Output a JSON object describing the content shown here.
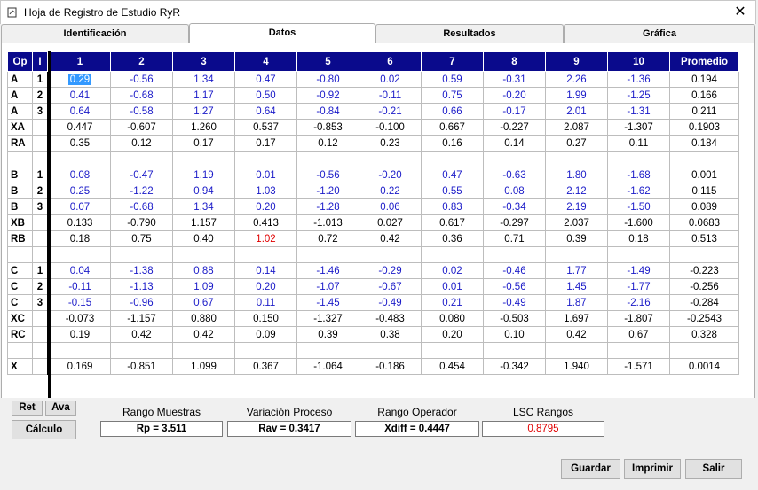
{
  "window": {
    "title": "Hoja de Registro de Estudio RyR",
    "close_label": "✕"
  },
  "tabs": [
    "Identificación",
    "Datos",
    "Resultados",
    "Gráfica"
  ],
  "active_tab": 1,
  "grid": {
    "header": [
      "Op",
      "I",
      "1",
      "2",
      "3",
      "4",
      "5",
      "6",
      "7",
      "8",
      "9",
      "10",
      "Promedio"
    ],
    "rows": [
      {
        "op": "A",
        "i": "1",
        "vals": [
          "0.29",
          "-0.56",
          "1.34",
          "0.47",
          "-0.80",
          "0.02",
          "0.59",
          "-0.31",
          "2.26",
          "-1.36"
        ],
        "prom": "0.194",
        "type": "data"
      },
      {
        "op": "A",
        "i": "2",
        "vals": [
          "0.41",
          "-0.68",
          "1.17",
          "0.50",
          "-0.92",
          "-0.11",
          "0.75",
          "-0.20",
          "1.99",
          "-1.25"
        ],
        "prom": "0.166",
        "type": "data"
      },
      {
        "op": "A",
        "i": "3",
        "vals": [
          "0.64",
          "-0.58",
          "1.27",
          "0.64",
          "-0.84",
          "-0.21",
          "0.66",
          "-0.17",
          "2.01",
          "-1.31"
        ],
        "prom": "0.211",
        "type": "data"
      },
      {
        "op": "XA",
        "i": "",
        "vals": [
          "0.447",
          "-0.607",
          "1.260",
          "0.537",
          "-0.853",
          "-0.100",
          "0.667",
          "-0.227",
          "2.087",
          "-1.307"
        ],
        "prom": "0.1903",
        "type": "calc"
      },
      {
        "op": "RA",
        "i": "",
        "vals": [
          "0.35",
          "0.12",
          "0.17",
          "0.17",
          "0.12",
          "0.23",
          "0.16",
          "0.14",
          "0.27",
          "0.11"
        ],
        "prom": "0.184",
        "type": "calc"
      },
      {
        "op": "",
        "i": "",
        "vals": [
          "",
          "",
          "",
          "",
          "",
          "",
          "",
          "",
          "",
          ""
        ],
        "prom": "",
        "type": "blank"
      },
      {
        "op": "B",
        "i": "1",
        "vals": [
          "0.08",
          "-0.47",
          "1.19",
          "0.01",
          "-0.56",
          "-0.20",
          "0.47",
          "-0.63",
          "1.80",
          "-1.68"
        ],
        "prom": "0.001",
        "type": "data"
      },
      {
        "op": "B",
        "i": "2",
        "vals": [
          "0.25",
          "-1.22",
          "0.94",
          "1.03",
          "-1.20",
          "0.22",
          "0.55",
          "0.08",
          "2.12",
          "-1.62"
        ],
        "prom": "0.115",
        "type": "data"
      },
      {
        "op": "B",
        "i": "3",
        "vals": [
          "0.07",
          "-0.68",
          "1.34",
          "0.20",
          "-1.28",
          "0.06",
          "0.83",
          "-0.34",
          "2.19",
          "-1.50"
        ],
        "prom": "0.089",
        "type": "data"
      },
      {
        "op": "XB",
        "i": "",
        "vals": [
          "0.133",
          "-0.790",
          "1.157",
          "0.413",
          "-1.013",
          "0.027",
          "0.617",
          "-0.297",
          "2.037",
          "-1.600"
        ],
        "prom": "0.0683",
        "type": "calc"
      },
      {
        "op": "RB",
        "i": "",
        "vals": [
          "0.18",
          "0.75",
          "0.40",
          "1.02",
          "0.72",
          "0.42",
          "0.36",
          "0.71",
          "0.39",
          "0.18"
        ],
        "prom": "0.513",
        "type": "calc",
        "red_index": 3
      },
      {
        "op": "",
        "i": "",
        "vals": [
          "",
          "",
          "",
          "",
          "",
          "",
          "",
          "",
          "",
          ""
        ],
        "prom": "",
        "type": "blank"
      },
      {
        "op": "C",
        "i": "1",
        "vals": [
          "0.04",
          "-1.38",
          "0.88",
          "0.14",
          "-1.46",
          "-0.29",
          "0.02",
          "-0.46",
          "1.77",
          "-1.49"
        ],
        "prom": "-0.223",
        "type": "data"
      },
      {
        "op": "C",
        "i": "2",
        "vals": [
          "-0.11",
          "-1.13",
          "1.09",
          "0.20",
          "-1.07",
          "-0.67",
          "0.01",
          "-0.56",
          "1.45",
          "-1.77"
        ],
        "prom": "-0.256",
        "type": "data"
      },
      {
        "op": "C",
        "i": "3",
        "vals": [
          "-0.15",
          "-0.96",
          "0.67",
          "0.11",
          "-1.45",
          "-0.49",
          "0.21",
          "-0.49",
          "1.87",
          "-2.16"
        ],
        "prom": "-0.284",
        "type": "data"
      },
      {
        "op": "XC",
        "i": "",
        "vals": [
          "-0.073",
          "-1.157",
          "0.880",
          "0.150",
          "-1.327",
          "-0.483",
          "0.080",
          "-0.503",
          "1.697",
          "-1.807"
        ],
        "prom": "-0.2543",
        "type": "calc"
      },
      {
        "op": "RC",
        "i": "",
        "vals": [
          "0.19",
          "0.42",
          "0.42",
          "0.09",
          "0.39",
          "0.38",
          "0.20",
          "0.10",
          "0.42",
          "0.67"
        ],
        "prom": "0.328",
        "type": "calc"
      },
      {
        "op": "",
        "i": "",
        "vals": [
          "",
          "",
          "",
          "",
          "",
          "",
          "",
          "",
          "",
          ""
        ],
        "prom": "",
        "type": "blank"
      },
      {
        "op": "X",
        "i": "",
        "vals": [
          "0.169",
          "-0.851",
          "1.099",
          "0.367",
          "-1.064",
          "-0.186",
          "0.454",
          "-0.342",
          "1.940",
          "-1.571"
        ],
        "prom": "0.0014",
        "type": "calc"
      }
    ]
  },
  "controls": {
    "ret_label": "Ret",
    "ava_label": "Ava",
    "calculo_label": "Cálculo",
    "rango_muestras_label": "Rango Muestras",
    "rango_muestras_value": "Rp = 3.511",
    "variacion_proceso_label": "Variación Proceso",
    "variacion_proceso_value": "Rav = 0.3417",
    "rango_operador_label": "Rango Operador",
    "rango_operador_value": "Xdiff = 0.4447",
    "lsc_rangos_label": "LSC Rangos",
    "lsc_rangos_value": "0.8795"
  },
  "footer": {
    "guardar_label": "Guardar",
    "imprimir_label": "Imprimir",
    "salir_label": "Salir"
  },
  "colors": {
    "header_bg": "#0a0a8c",
    "data_blue": "#1a1ac8",
    "alert_red": "#e00000",
    "selection": "#3399ff"
  }
}
